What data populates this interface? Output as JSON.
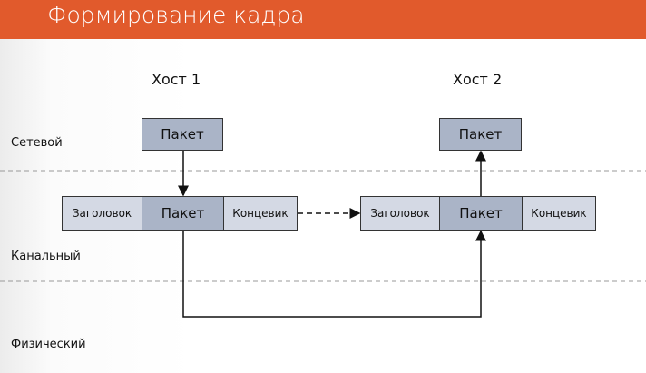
{
  "title": "Формирование кадра",
  "hosts": [
    "Хост 1",
    "Хост 2"
  ],
  "layers": {
    "network": "Сетевой",
    "link": "Канальный",
    "physical": "Физический"
  },
  "packet": "Пакет",
  "header": "Заголовок",
  "trailer": "Концевик",
  "colors": {
    "accent": "#e15a2c",
    "packet": "#aab4c7",
    "frame_part": "#d4d9e4"
  }
}
